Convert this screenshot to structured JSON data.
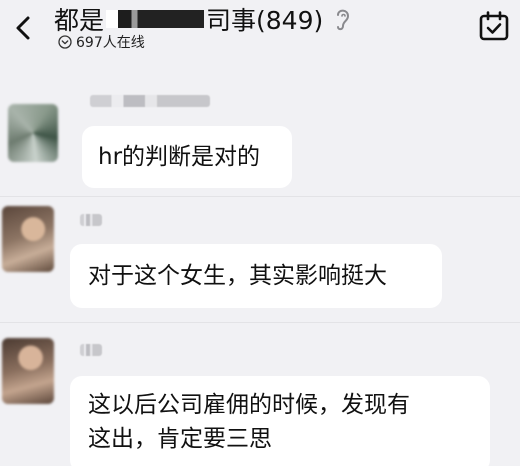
{
  "header": {
    "title_prefix": "都是",
    "title_suffix": "司事(849)",
    "online": "697人在线"
  },
  "messages": [
    {
      "text": "hr的判断是对的"
    },
    {
      "text": "对于这个女生，其实影响挺大"
    },
    {
      "line1": "这以后公司雇佣的时候，发现有",
      "line2": "这出，肯定要三思"
    }
  ]
}
